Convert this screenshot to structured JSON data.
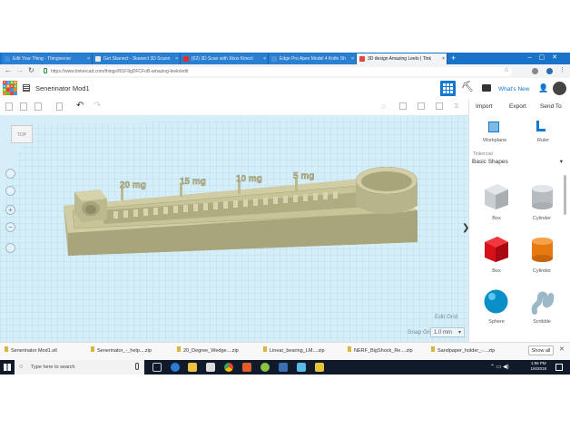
{
  "browser": {
    "tabs": [
      {
        "label": "Edit Your Thing - Thingiverse",
        "color": "#3a8ee6"
      },
      {
        "label": "Get Skanect - Skanect 3D Scann",
        "color": "#e8e8e8"
      },
      {
        "label": "(62) 3D Scan with Xbox Kinect",
        "color": "#e52d27"
      },
      {
        "label": "Edge Pro Apex Model 4 Knife Sh",
        "color": "#4a90d9"
      },
      {
        "label": "3D design Amazing Leelo | Tink",
        "color": "#e8443a"
      }
    ],
    "url": "https://www.tinkercad.com/things/f01F9gDFCFoB-amazing-leelo/edit"
  },
  "app": {
    "design_name": "Senerinator Mod1",
    "logo_letters": [
      "T",
      "I",
      "N",
      "K",
      "E",
      "R",
      "C",
      "A",
      "D"
    ],
    "header_buttons": {
      "whats_new": "What's New"
    },
    "toolbar": {
      "import": "Import",
      "export": "Export",
      "send_to": "Send To"
    },
    "view_cube": "TOP",
    "tools": {
      "workplane": "Workplane",
      "ruler": "Ruler"
    },
    "library": {
      "source": "Tinkercad",
      "category": "Basic Shapes"
    },
    "shapes": [
      {
        "name": "Box",
        "icon": "box-hole-icon"
      },
      {
        "name": "Cylinder",
        "icon": "cylinder-hole-icon"
      },
      {
        "name": "Box",
        "icon": "box-icon"
      },
      {
        "name": "Cylinder",
        "icon": "cylinder-icon"
      },
      {
        "name": "Sphere",
        "icon": "sphere-icon"
      },
      {
        "name": "Scribble",
        "icon": "scribble-icon"
      }
    ],
    "model_labels": [
      "20 mg",
      "15 mg",
      "10 mg",
      "5 mg"
    ],
    "edit_grid": "Edit Grid",
    "snap_grid_label": "Snap Grid",
    "snap_grid_value": "1.0 mm"
  },
  "downloads": {
    "items": [
      "Senerinator Mod1.stl",
      "Senerinator_-_help....zip",
      "20_Degree_Wedge....zip",
      "Linear_bearing_LM....zip",
      "NERF_BigShock_Re....zip",
      "Sandpaper_holder_-....zip"
    ],
    "show_all": "Show all"
  },
  "taskbar": {
    "search_placeholder": "Type here to search",
    "time": "1:56 PM",
    "date": "1/6/2019"
  },
  "colors": {
    "accent": "#1477d1",
    "model": "#c7c498",
    "workplane": "#d6eef8"
  }
}
